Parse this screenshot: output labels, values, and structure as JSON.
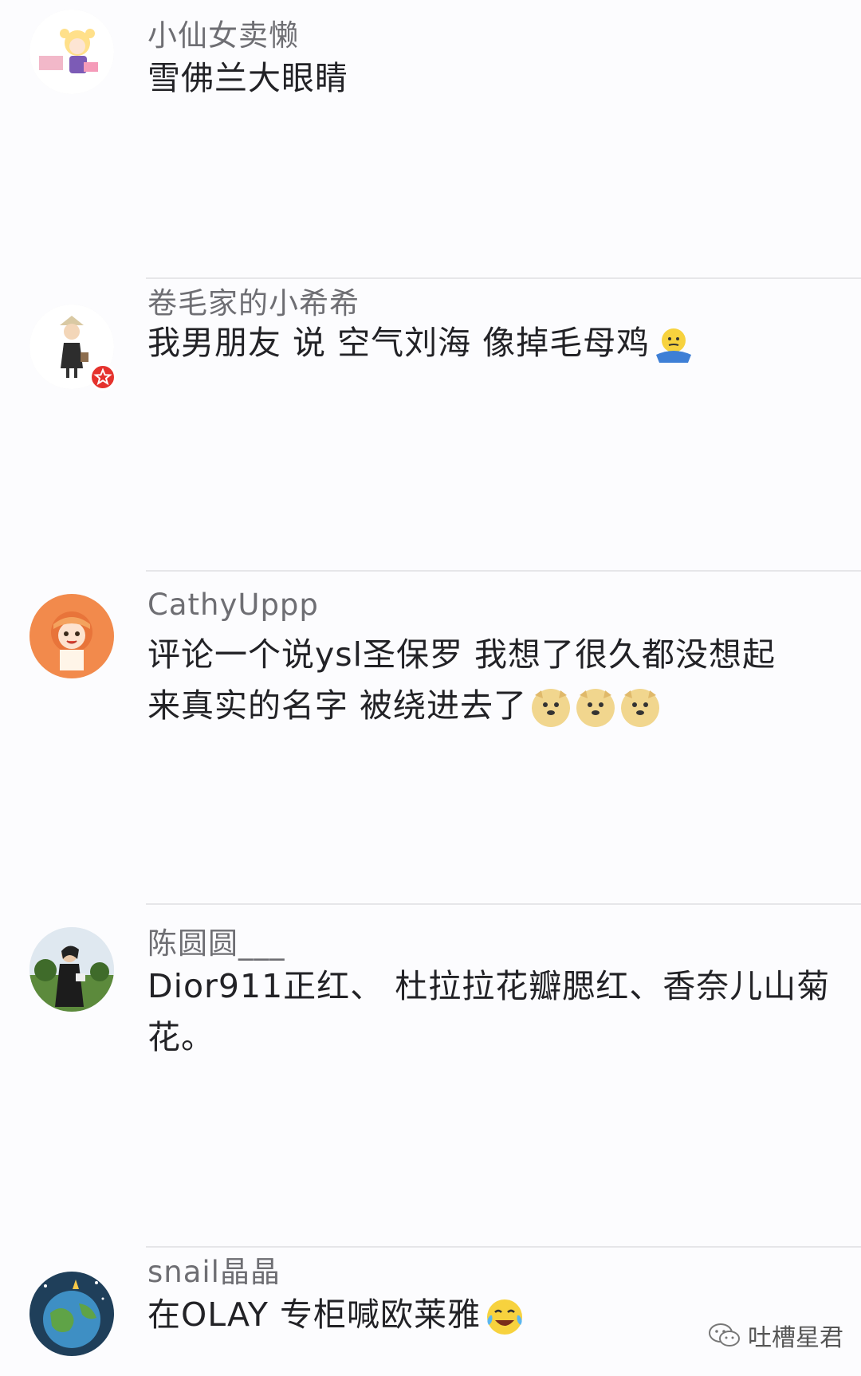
{
  "comments": [
    {
      "username": "小仙女卖懒",
      "text": "雪佛兰大眼睛",
      "avatar_icon": "anime-girl-avatar"
    },
    {
      "username": "卷毛家的小希希",
      "text": "我男朋友 说 空气刘海 像掉毛母鸡",
      "avatar_icon": "girl-illustration-avatar",
      "badge_icon": "star-badge",
      "emoji": "shrug-emoji"
    },
    {
      "username": "CathyUppp",
      "text_line1": "评论一个说ysl圣保罗  我想了很久都没想起",
      "text_line2": "来真实的名字  被绕进去了",
      "avatar_icon": "umaru-avatar",
      "emoji": "doge-emoji"
    },
    {
      "username": "陈圆圆___",
      "text": "Dior911正红、 杜拉拉花瓣腮红、香奈儿山菊花。",
      "avatar_icon": "photo-avatar"
    },
    {
      "username": "snail晶晶",
      "text": "在OLAY 专柜喊欧莱雅",
      "avatar_icon": "earth-avatar",
      "emoji": "laugh-cry-emoji"
    }
  ],
  "watermark": {
    "text": "吐槽星君",
    "icon": "wechat-icon"
  },
  "colors": {
    "username": "#6e6e73",
    "text": "#222226",
    "divider": "#e6e6e9",
    "badge": "#e5322d"
  }
}
